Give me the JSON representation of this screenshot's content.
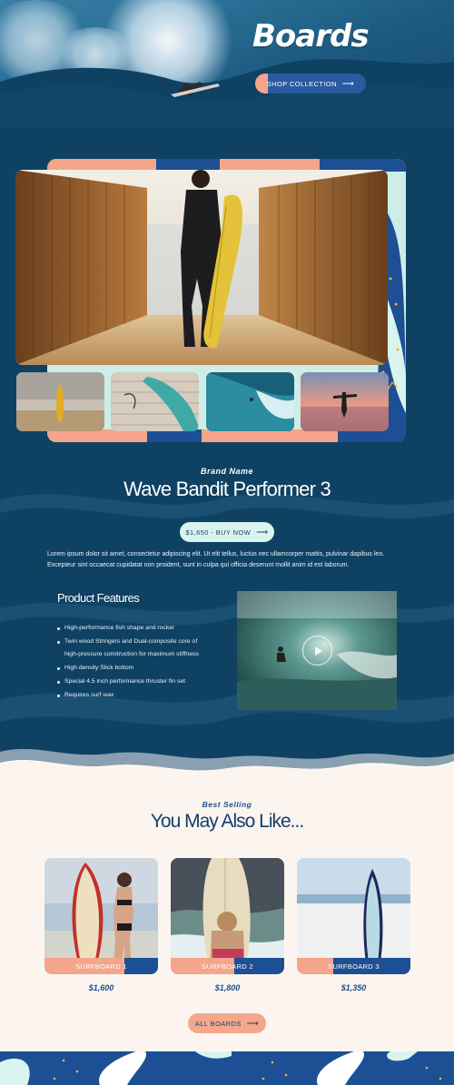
{
  "hero": {
    "title": "Boards",
    "shop_button": "SHOP COLLECTION",
    "arrow": "⟶"
  },
  "gallery": {
    "main_alt": "Surfer walking to beach between wooden fences",
    "thumbnails": [
      "yellow-surfboard-on-beach",
      "surfboard-on-deck",
      "surfer-in-wave-barrel",
      "surfer-at-sunset"
    ]
  },
  "product": {
    "brand": "Brand Name",
    "title": "Wave Bandit Performer 3",
    "buy_button": "$1,650 - BUY NOW",
    "description": "Lorem ipsum dolor sit amet, consectetur adipiscing elit. Ut elit tellus, luctus nec ullamcorper mattis, pulvinar dapibus leo. Excepteur sint occaecat cupidatat non proident, sunt in culpa qui officia deserunt mollit anim id est laborum.",
    "features_title": "Product Features",
    "features": [
      "High-performance fish shape and rocker",
      "Twin wood Stringers and Dual-composite core of high-pressure construction for maximum stiffness",
      "High density Slick bottom",
      "Special 4.5 inch performance thruster fin set",
      "Requires surf wax"
    ]
  },
  "best_selling": {
    "label": "Best Selling",
    "title": "You May Also Like...",
    "items": [
      {
        "name": "SURFBOARD 1",
        "price": "$1,600"
      },
      {
        "name": "SURFBOARD 2",
        "price": "$1,800"
      },
      {
        "name": "SURFBOARD 3",
        "price": "$1,350"
      }
    ],
    "all_button": "ALL BOARDS"
  },
  "colors": {
    "navy": "#0f4163",
    "accent_blue": "#1d4f94",
    "salmon": "#f4a58a",
    "mint": "#cdeee6",
    "cream": "#fcf5ef"
  }
}
